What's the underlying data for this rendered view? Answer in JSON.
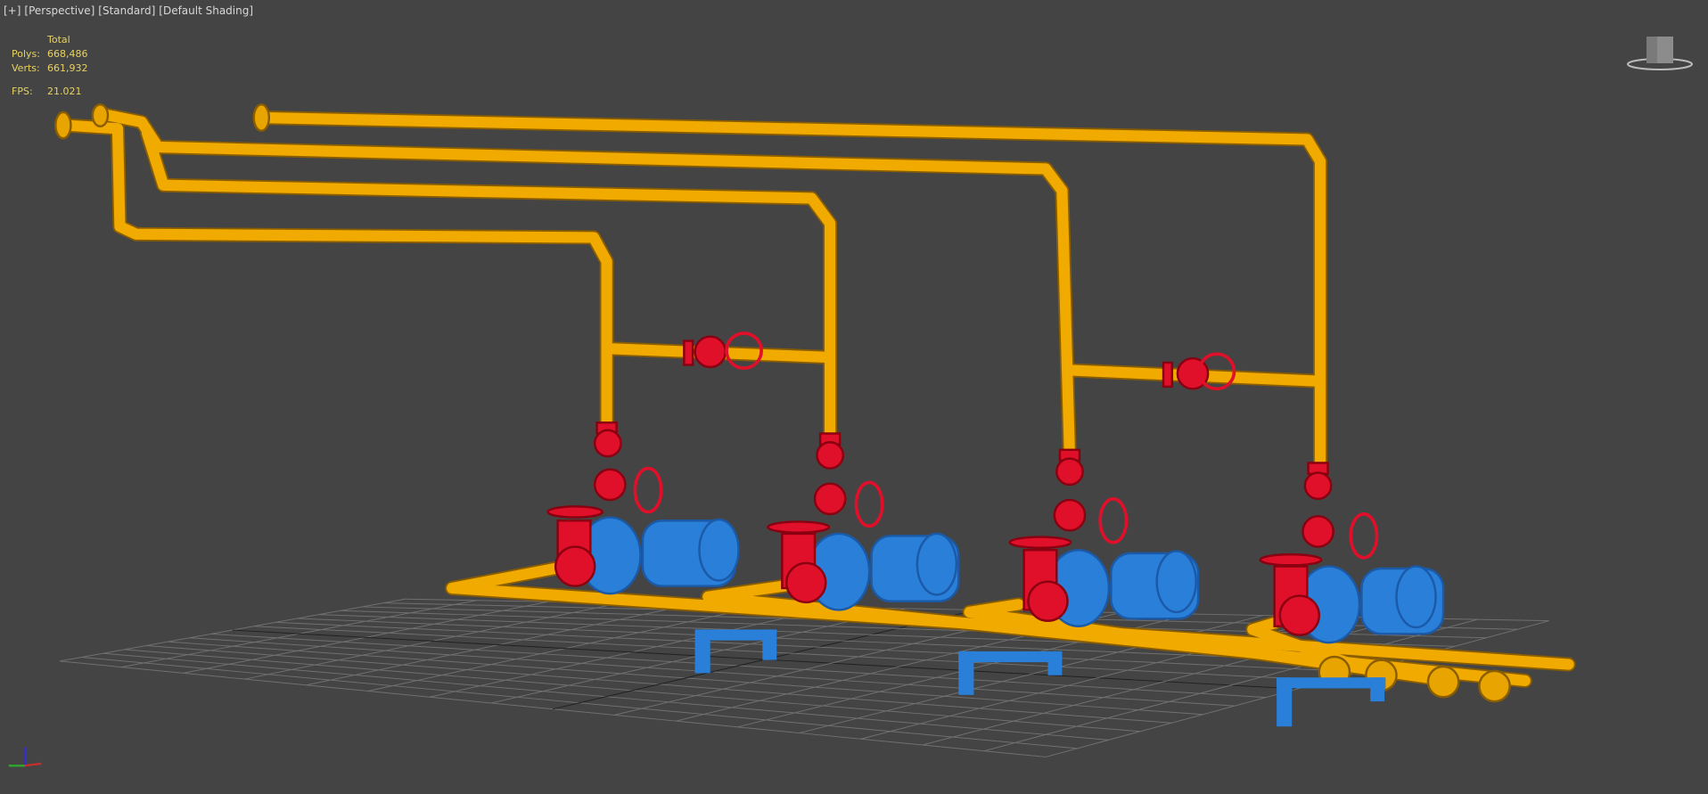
{
  "viewport": {
    "labels": [
      "[+]",
      "[Perspective]",
      "[Standard]",
      "[Default Shading]"
    ]
  },
  "stats": {
    "header": "Total",
    "polys_label": "Polys:",
    "polys": "668,486",
    "verts_label": "Verts:",
    "verts": "661,932",
    "fps_label": "FPS:",
    "fps": "21.021"
  },
  "colors": {
    "background": "#444444",
    "pipe": "#f0aa00",
    "valve": "#e0102a",
    "pump": "#2a7fd8",
    "grid": "#707070"
  }
}
